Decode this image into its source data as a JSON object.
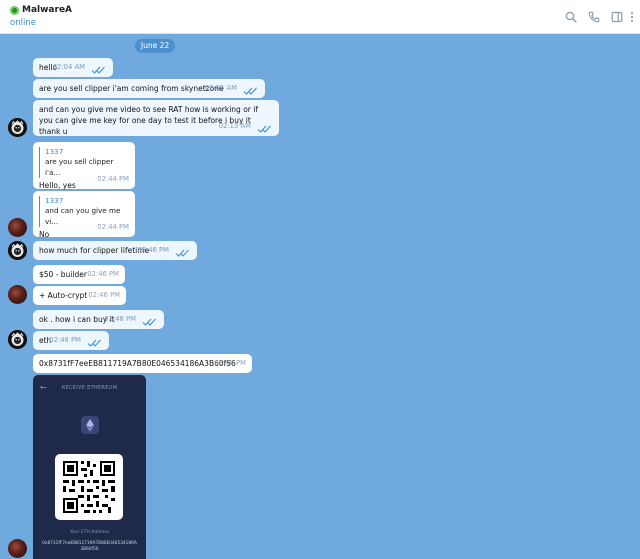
{
  "header": {
    "title": "MalwareA",
    "status": "online",
    "icons": [
      "search-icon",
      "phone-icon",
      "sidebar-toggle-icon",
      "more-icon"
    ]
  },
  "date_separator": "June 22",
  "messages": [
    {
      "text": "hello",
      "time": "02:04 AM",
      "direction": "out"
    },
    {
      "text": "are you sell clipper i'am coming from skynetzone",
      "time": "02:05 AM",
      "direction": "out"
    },
    {
      "text": "and can you give me video to see RAT how is working or if you can give me key for one day to test it before i buy it thank u",
      "time": "02:13 AM",
      "direction": "out"
    },
    {
      "quote_name": "1337",
      "quote_text": "are you sell clipper i'a...",
      "text": "Hello, yes",
      "time": "02:44 PM",
      "direction": "in"
    },
    {
      "quote_name": "1337",
      "quote_text": "and can you give me vi...",
      "text": "No",
      "time": "02:44 PM",
      "direction": "in"
    },
    {
      "text": "how much for clipper lifetime",
      "time": "02:46 PM",
      "direction": "out"
    },
    {
      "text": "$50 - builder",
      "time": "02:46 PM",
      "direction": "in"
    },
    {
      "text": "+ Auto-crypt",
      "time": "02:46 PM",
      "direction": "in"
    },
    {
      "text": "ok . how i can buy it",
      "time": "02:48 PM",
      "direction": "out"
    },
    {
      "text": "eth",
      "time": "02:48 PM",
      "direction": "out"
    },
    {
      "text": "0x8731fF7eeEB811719A7B80E046534186A3B60f56",
      "time": "02:49 PM",
      "direction": "in"
    }
  ],
  "image_message": {
    "screen_title": "RECEIVE ETHEREUM",
    "back_glyph": "←",
    "address_label": "Your ETH Address",
    "address": "0x8731fF7eeEB811719A7B80E046534186A3B60f56"
  },
  "colors": {
    "chat_background": "#6fa9de",
    "accent": "#3a8fd6",
    "outgoing_bubble": "#eef7ff",
    "incoming_bubble": "#ffffff",
    "image_background": "#1e2a48"
  }
}
